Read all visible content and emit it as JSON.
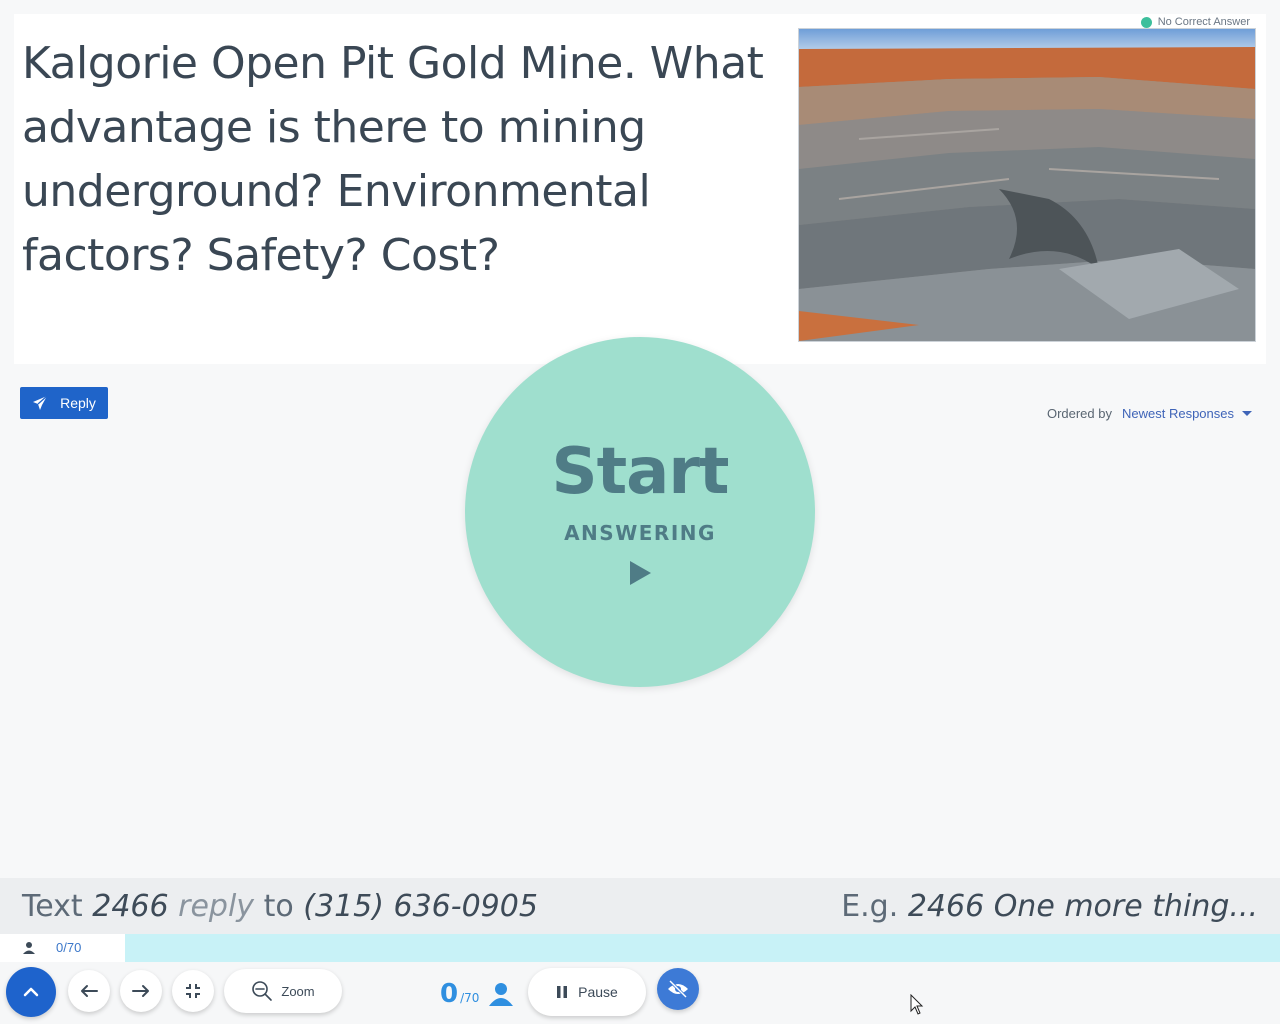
{
  "question": {
    "text": "Kalgorie Open Pit Gold Mine.  What advantage is there to mining underground?  Environmental factors? Safety? Cost?",
    "badge": "No Correct Answer",
    "badge_color": "#3dbf9c"
  },
  "reply_button": {
    "label": "Reply",
    "color": "#1f64c9"
  },
  "ordering": {
    "label": "Ordered by",
    "selected": "Newest Responses"
  },
  "start": {
    "title": "Start",
    "subtitle": "ANSWERING",
    "color": "#9fdfce",
    "text_color": "#4f7c86"
  },
  "instructions": {
    "left": {
      "text": "Text",
      "code": "2466",
      "reply": "reply",
      "to": "to",
      "phone": "(315) 636-0905"
    },
    "right": {
      "eg": "E.g.",
      "example": "2466 One more thing..."
    }
  },
  "participation": {
    "count_label": "0/70",
    "responded": 0,
    "total": 70,
    "fraction": 0.0
  },
  "toolbar": {
    "zoom_label": "Zoom",
    "responses_count": "0",
    "responses_total": "/70",
    "pause_label": "Pause",
    "accent": "#1e63cc"
  },
  "icons": {
    "up": "chevron-up-icon",
    "back": "arrow-left-icon",
    "forward": "arrow-right-icon",
    "fullscreen": "exit-fullscreen-icon",
    "zoom": "zoom-out-icon",
    "person": "person-icon",
    "pause": "pause-icon",
    "hide": "eye-off-icon",
    "send": "paper-plane-icon",
    "play": "play-icon"
  }
}
